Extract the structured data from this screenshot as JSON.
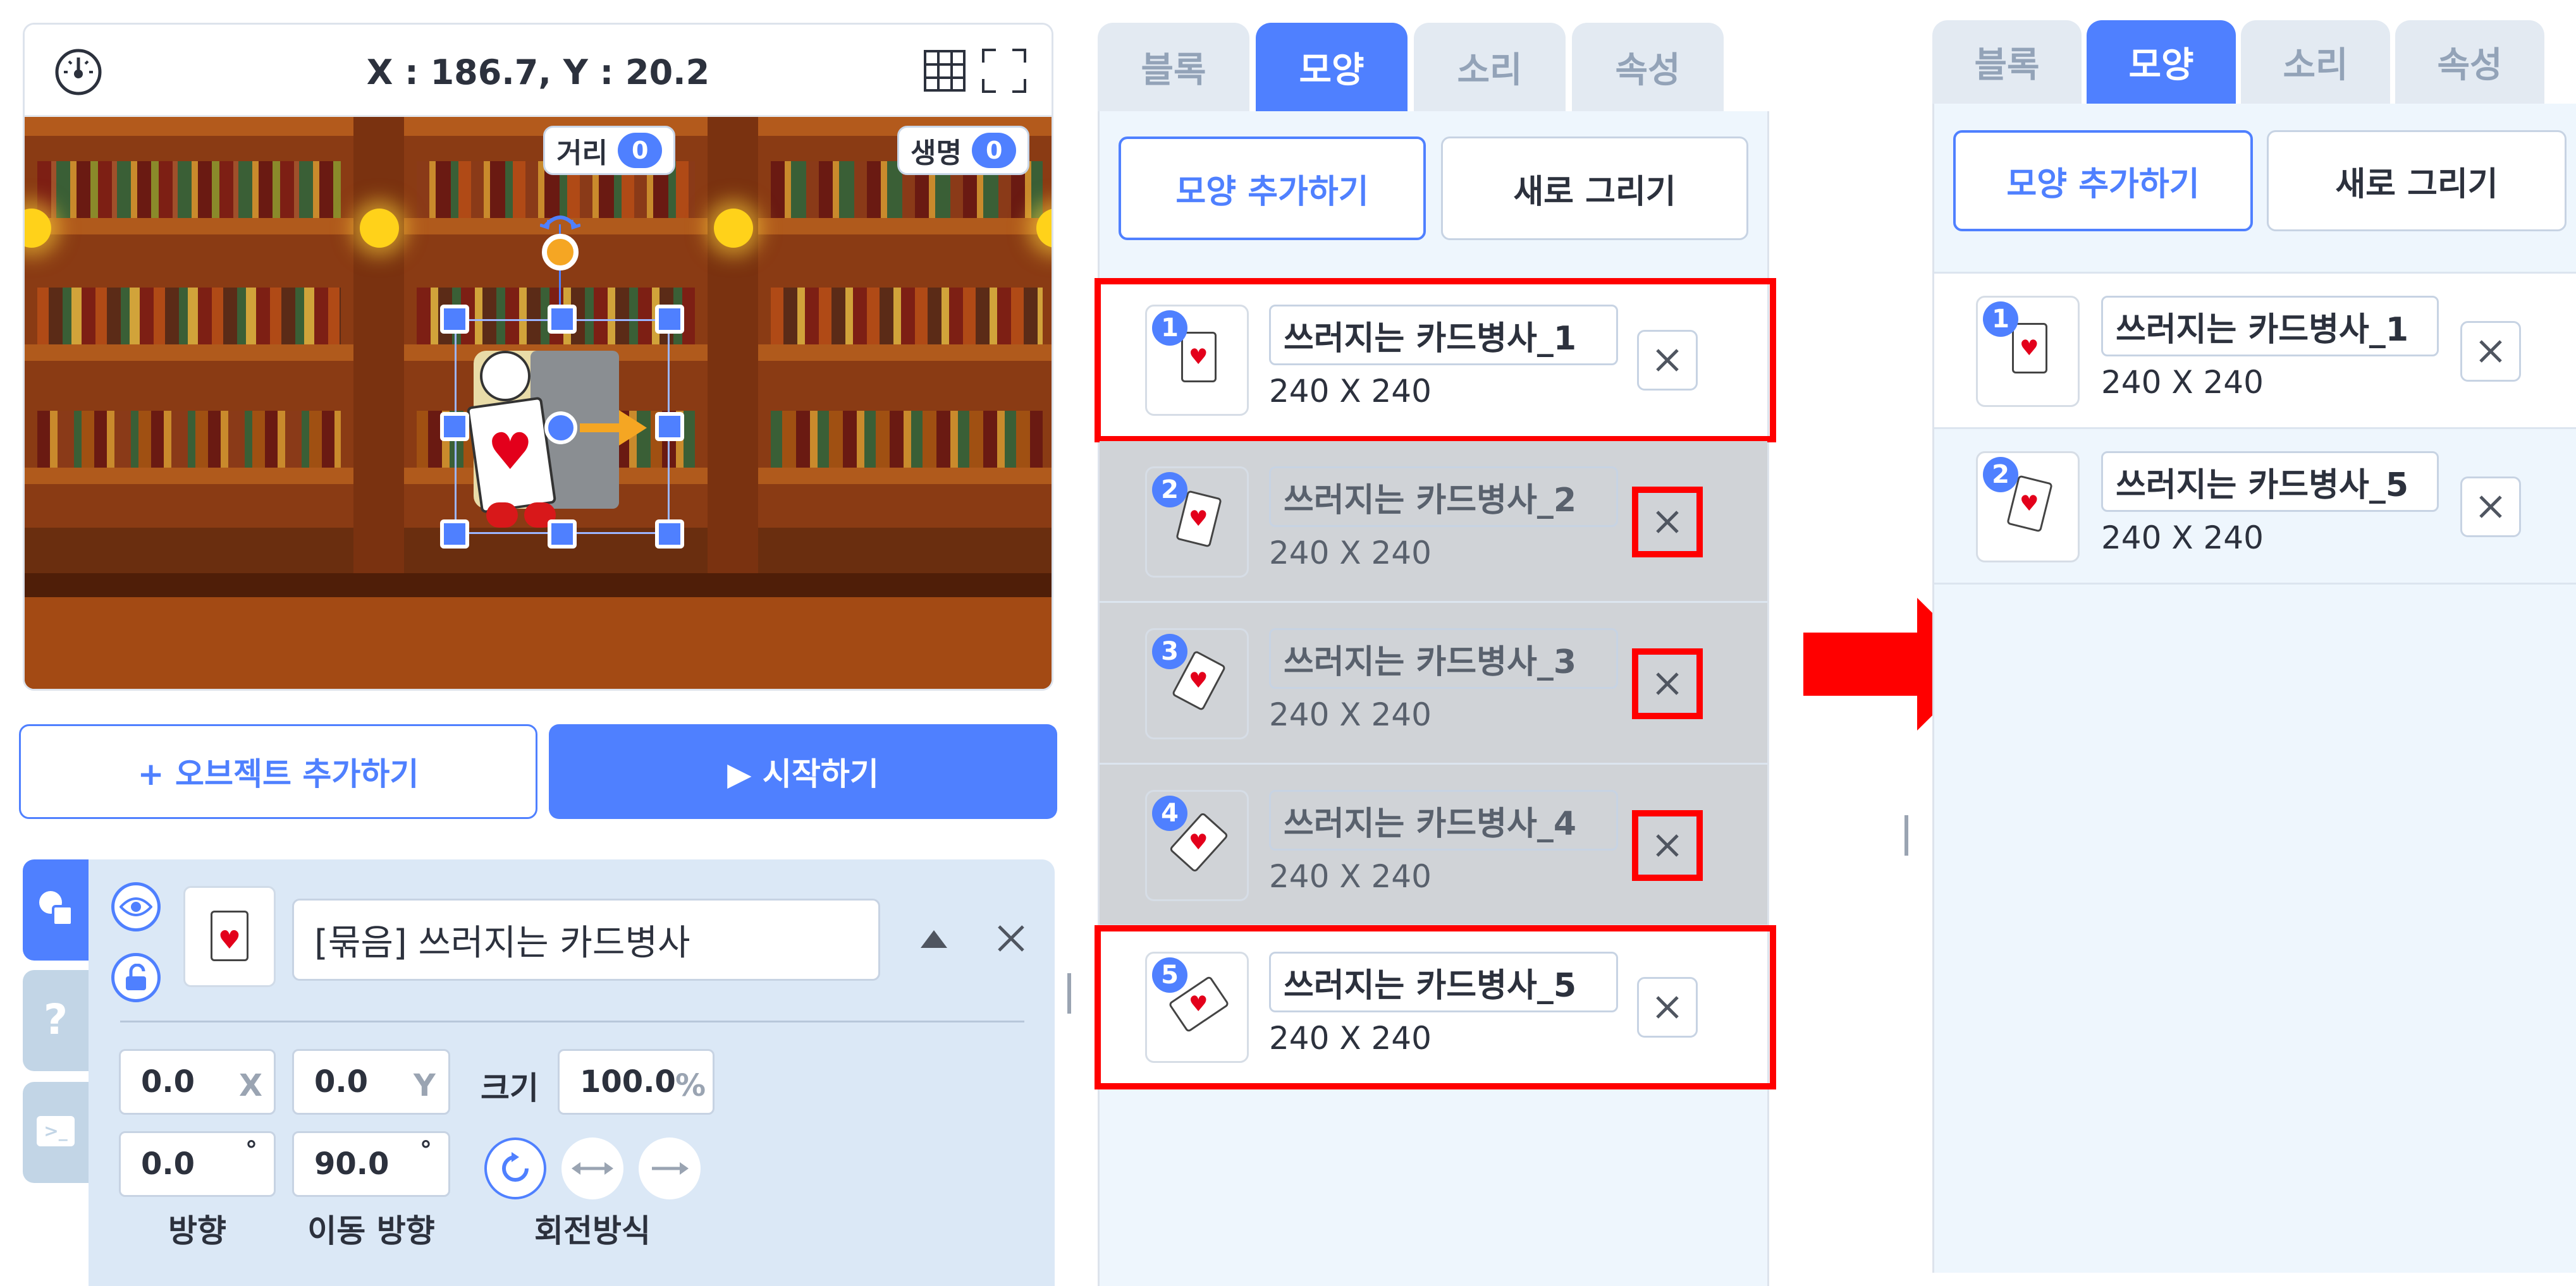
{
  "stage": {
    "coord_text": "X : 186.7, Y : 20.2",
    "speed_icon": "speedometer-icon",
    "grid_icon": "grid-icon",
    "fullscreen_icon": "fullscreen-icon",
    "hud_distance": {
      "label": "거리",
      "value": "0"
    },
    "hud_life": {
      "label": "생명",
      "value": "0"
    }
  },
  "buttons": {
    "add_object": "+ 오브젝트 추가하기",
    "start": "▶ 시작하기"
  },
  "object_panel": {
    "side_tabs": [
      "objects-icon",
      "help-icon",
      "console-icon"
    ],
    "help_label": "?",
    "console_label": ">_",
    "object_name": "[묶음] 쓰러지는 카드병사",
    "x_value": "0.0",
    "x_unit": "X",
    "y_value": "0.0",
    "y_unit": "Y",
    "size_label": "크기",
    "size_value": "100.0",
    "size_unit": "%",
    "direction_value": "0.0",
    "move_direction_value": "90.0",
    "degree_unit": "°",
    "direction_label": "방향",
    "move_direction_label": "이동 방향",
    "rotation_label": "회전방식"
  },
  "tabs": [
    "블록",
    "모양",
    "소리",
    "속성"
  ],
  "active_tab": "모양",
  "shape_buttons": {
    "add_shape": "모양 추가하기",
    "new_drawing": "새로 그리기"
  },
  "shapes_before": [
    {
      "number": "1",
      "name": "쓰러지는 카드병사_1",
      "dims": "240 X 240"
    },
    {
      "number": "2",
      "name": "쓰러지는 카드병사_2",
      "dims": "240 X 240"
    },
    {
      "number": "3",
      "name": "쓰러지는 카드병사_3",
      "dims": "240 X 240"
    },
    {
      "number": "4",
      "name": "쓰러지는 카드병사_4",
      "dims": "240 X 240"
    },
    {
      "number": "5",
      "name": "쓰러지는 카드병사_5",
      "dims": "240 X 240"
    }
  ],
  "shapes_after": [
    {
      "number": "1",
      "name": "쓰러지는 카드병사_1",
      "dims": "240 X 240"
    },
    {
      "number": "2",
      "name": "쓰러지는 카드병사_5",
      "dims": "240 X 240"
    }
  ],
  "colors": {
    "accent": "#4f80ff",
    "highlight": "#ff0000",
    "panel": "#eef6fd",
    "removed_row": "#d0d3d7"
  },
  "arrow_icon": "right-arrow-icon"
}
